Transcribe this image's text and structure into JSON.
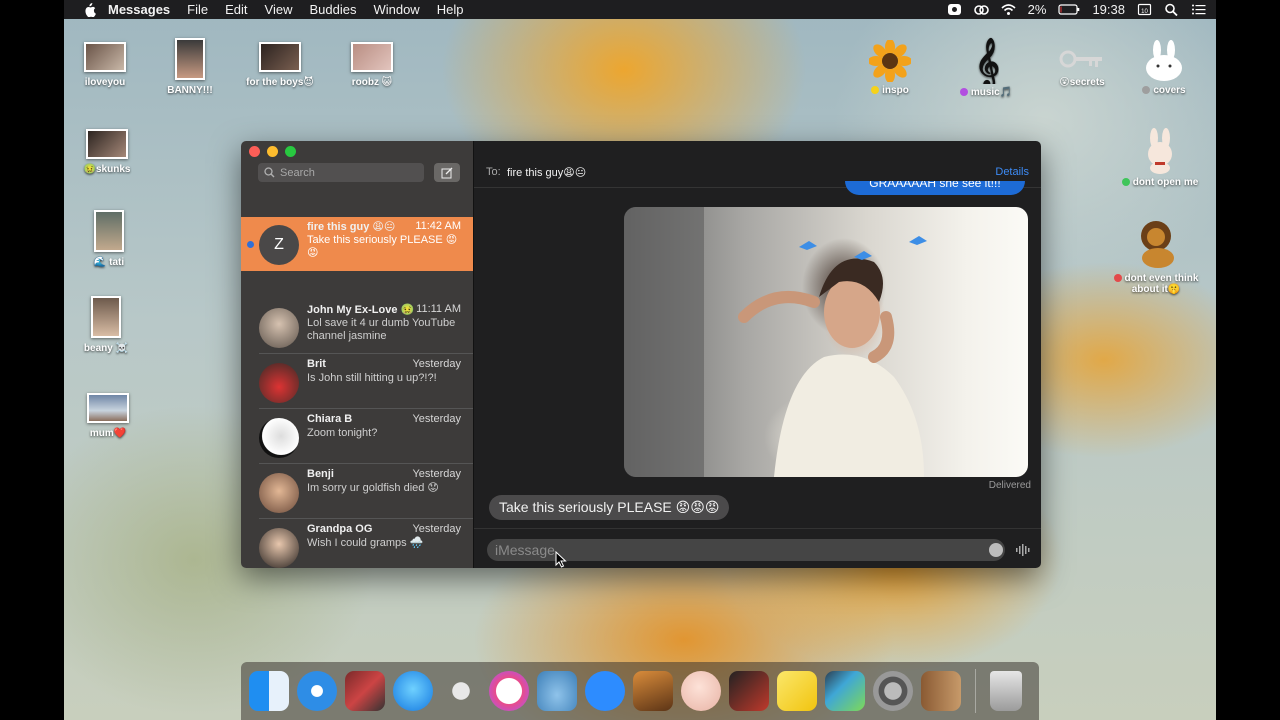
{
  "menubar": {
    "app_name": "Messages",
    "menus": [
      "File",
      "Edit",
      "View",
      "Buddies",
      "Window",
      "Help"
    ],
    "battery": "2%",
    "time": "19:38"
  },
  "desktop_icons": {
    "left": [
      {
        "label": "iloveyou",
        "emoji_suffix": ""
      },
      {
        "label": "BANNY!!!",
        "emoji_suffix": ""
      },
      {
        "label": "for the boys",
        "emoji_suffix": "😈"
      },
      {
        "label": "roobz",
        "emoji_suffix": "😺"
      },
      {
        "label": "skunks",
        "emoji_prefix": "🤢"
      },
      {
        "label": "tati",
        "emoji_prefix": "🌊"
      },
      {
        "label": "beany",
        "emoji_suffix": "☠️"
      },
      {
        "label": "mum",
        "emoji_suffix": "❤️"
      }
    ],
    "right": [
      {
        "label": "inspo",
        "dot_color": "#f5d21b"
      },
      {
        "label": "music🎵",
        "dot_color": "#b24fe0"
      },
      {
        "label": "secrets",
        "emoji_prefix": "😮"
      },
      {
        "label": "covers",
        "dot_color": "#9e9e9e"
      },
      {
        "label": "dont open me",
        "dot_color": "#3fc55a"
      },
      {
        "label": "dont even think about it🤫",
        "dot_color": "#e34a4a"
      }
    ]
  },
  "sidebar": {
    "search_placeholder": "Search",
    "conversations": [
      {
        "name": "fire this guy 😩😐",
        "time": "11:42 AM",
        "preview": "Take this seriously PLEASE 😡😡",
        "avatar_letter": "Z",
        "active": true,
        "unread": true
      },
      {
        "name": "John My Ex-Love 🤢",
        "time": "11:11 AM",
        "preview": "Lol save it 4 ur dumb YouTube channel jasmine"
      },
      {
        "name": "Brit",
        "time": "Yesterday",
        "preview": "Is John still hitting u up?!?!"
      },
      {
        "name": "Chiara B",
        "time": "Yesterday",
        "preview": "Zoom tonight?"
      },
      {
        "name": "Benji",
        "time": "Yesterday",
        "preview": "Im sorry ur goldfish died 😟"
      },
      {
        "name": "Grandpa OG",
        "time": "Yesterday",
        "preview": "Wish I could gramps 🌧️"
      }
    ]
  },
  "chat": {
    "to_label": "To:",
    "recipient": "fire this guy😩😐",
    "details_label": "Details",
    "partial_bubble_text": "GRAAAAAH she see it!!!",
    "delivered_label": "Delivered",
    "incoming_message": "Take this seriously PLEASE 😡😡😡",
    "input_placeholder": "iMessage"
  },
  "dock": {
    "apps": [
      "finder",
      "safari",
      "photo-booth",
      "messages",
      "clipart",
      "itunes",
      "seal",
      "zoom",
      "garageband",
      "face",
      "photo-red",
      "stickies",
      "preview",
      "system-preferences",
      "contacts",
      "trash"
    ]
  }
}
